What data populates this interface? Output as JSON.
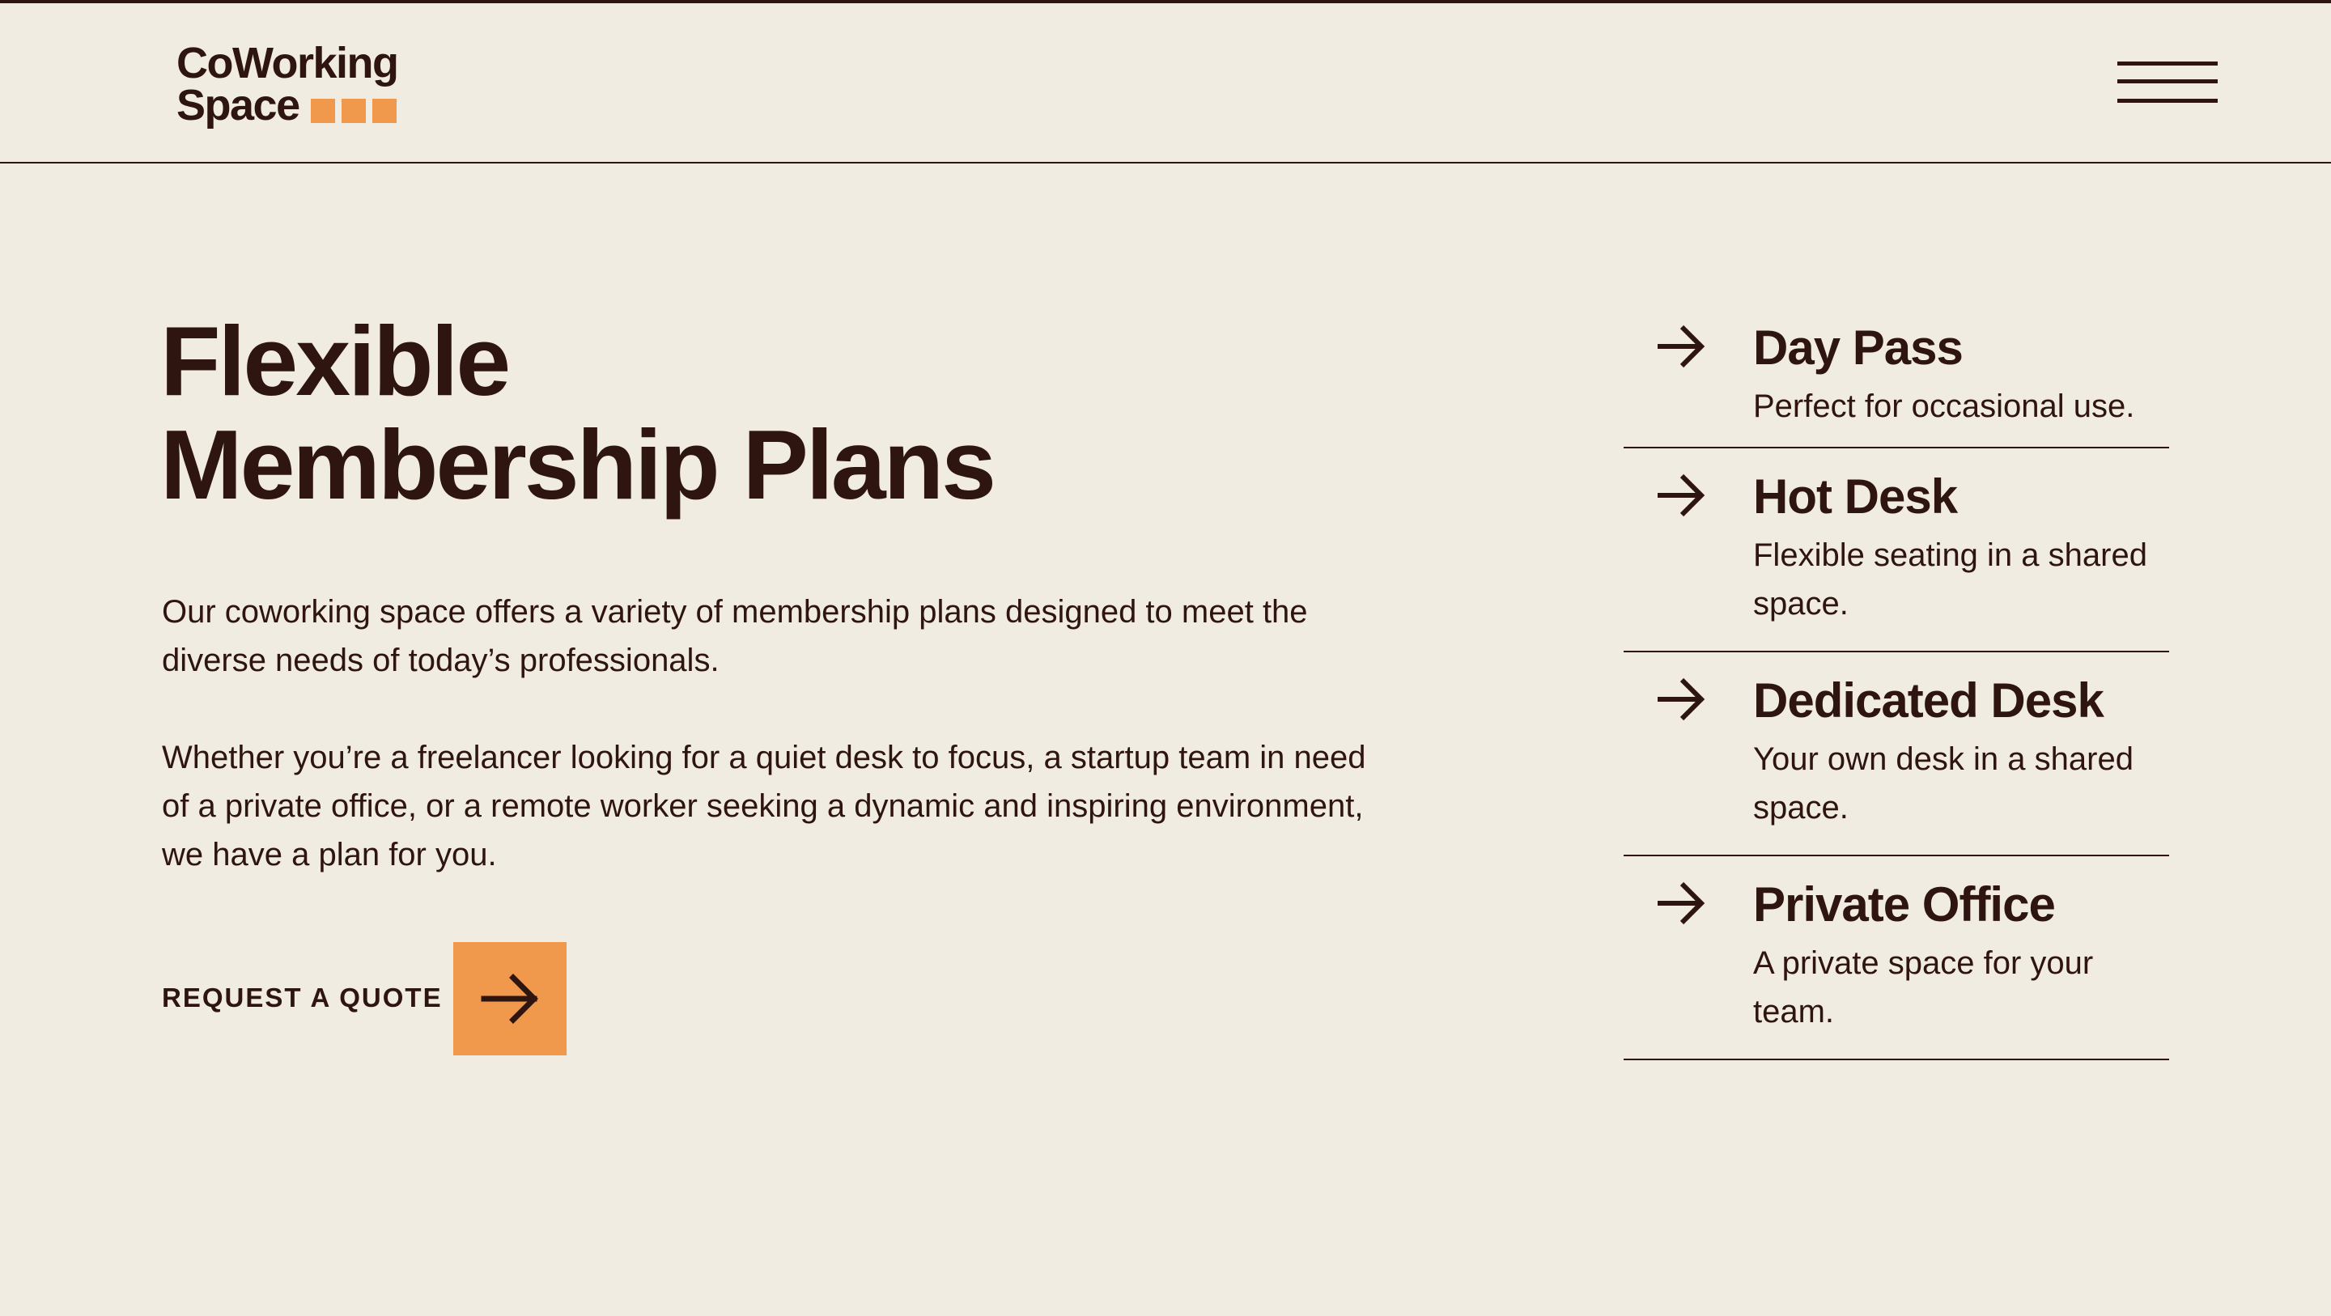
{
  "brand": {
    "name_line1": "CoWorking",
    "name_line2": "Space",
    "accent_color": "#f0994d",
    "text_color": "#2e150f",
    "background_color": "#f1ece1"
  },
  "header": {
    "menu_icon": "hamburger-menu-icon"
  },
  "hero": {
    "title_line1": "Flexible",
    "title_line2": "Membership Plans",
    "paragraph1": "Our coworking space offers a variety of membership plans designed to meet the diverse needs of today’s professionals.",
    "paragraph2": "Whether you’re a freelancer looking for a quiet desk to focus, a startup team in need of a private office, or a remote worker seeking a dynamic and inspiring environment, we have a plan for you.",
    "cta_label": "REQUEST A QUOTE",
    "cta_icon": "arrow-right-icon"
  },
  "plans": [
    {
      "name": "Day Pass",
      "description": "Perfect for occasional use.",
      "icon": "arrow-right-icon"
    },
    {
      "name": "Hot Desk",
      "description": "Flexible seating in a shared space.",
      "icon": "arrow-right-icon"
    },
    {
      "name": "Dedicated Desk",
      "description": "Your own desk in a shared space.",
      "icon": "arrow-right-icon"
    },
    {
      "name": "Private Office",
      "description": "A private space for your team.",
      "icon": "arrow-right-icon"
    }
  ]
}
